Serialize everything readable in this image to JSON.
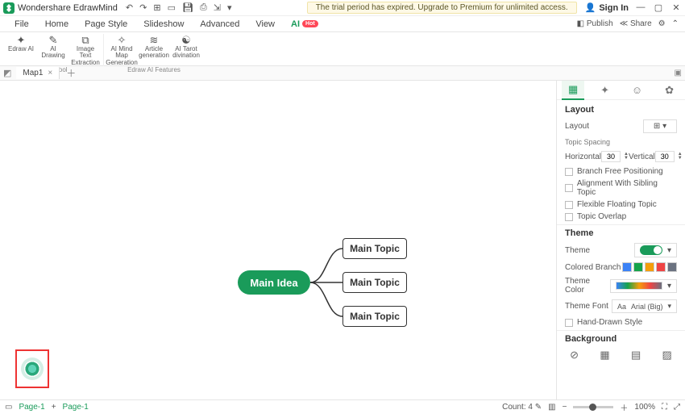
{
  "app": {
    "title": "Wondershare EdrawMind"
  },
  "titlebar": {
    "trial": "The trial period has expired. Upgrade to Premium for unlimited access.",
    "signin": "Sign In"
  },
  "menubar": {
    "tabs": [
      "File",
      "Home",
      "Page Style",
      "Slideshow",
      "Advanced",
      "View"
    ],
    "ai": "AI",
    "ai_badge": "Hot",
    "publish": "Publish",
    "share": "Share"
  },
  "ribbon": {
    "group1": {
      "label": "smart tool",
      "items": [
        {
          "icon": "✦",
          "label": "Edraw\nAI"
        },
        {
          "icon": "✎",
          "label": "AI\nDrawing"
        },
        {
          "icon": "⧉",
          "label": "Image Text\nExtraction"
        }
      ]
    },
    "group2": {
      "label": "Edraw AI Features",
      "items": [
        {
          "icon": "✧",
          "label": "AI Mind Map\nGeneration"
        },
        {
          "icon": "≋",
          "label": "Article\ngeneration"
        },
        {
          "icon": "☯",
          "label": "AI Tarot\ndivination"
        }
      ]
    }
  },
  "doc_tabs": {
    "name": "Map1"
  },
  "mindmap": {
    "main": "Main Idea",
    "topics": [
      "Main Topic",
      "Main Topic",
      "Main Topic"
    ]
  },
  "panel": {
    "layout_title": "Layout",
    "layout_label": "Layout",
    "spacing_title": "Topic Spacing",
    "horizontal": "Horizontal",
    "h_val": "30",
    "vertical": "Vertical",
    "v_val": "30",
    "checks": [
      "Branch Free Positioning",
      "Alignment With Sibling Topic",
      "Flexible Floating Topic",
      "Topic Overlap"
    ],
    "theme_title": "Theme",
    "theme_label": "Theme",
    "colored_branch": "Colored Branch",
    "theme_color": "Theme Color",
    "theme_font": "Theme Font",
    "font_val": "Arial (Big)",
    "hand_drawn": "Hand-Drawn Style",
    "background_title": "Background"
  },
  "status": {
    "page": "Page-1",
    "page2": "Page-1",
    "count": "Count: 4",
    "zoom": "100%"
  }
}
